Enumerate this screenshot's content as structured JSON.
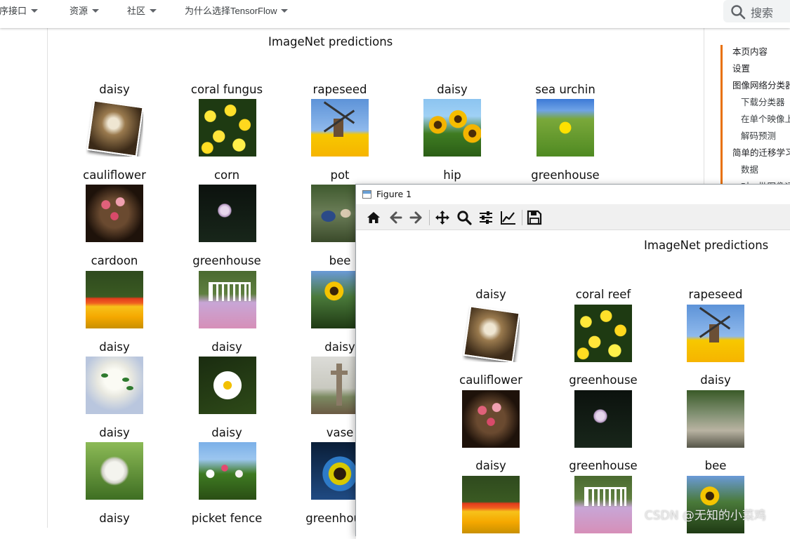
{
  "nav": {
    "items": [
      {
        "label": "程序接口"
      },
      {
        "label": "资源"
      },
      {
        "label": "社区"
      },
      {
        "label": "为什么选择TensorFlow"
      }
    ],
    "search_placeholder": "搜索"
  },
  "main_figure": {
    "title": "ImageNet predictions",
    "rows": [
      [
        "daisy",
        "coral fungus",
        "rapeseed",
        "daisy",
        "sea urchin"
      ],
      [
        "cauliflower",
        "corn",
        "pot",
        "hip",
        "greenhouse"
      ],
      [
        "cardoon",
        "greenhouse",
        "bee"
      ],
      [
        "daisy",
        "daisy",
        "daisy"
      ],
      [
        "daisy",
        "daisy",
        "vase"
      ],
      [
        "daisy",
        "picket fence",
        "greenhouse"
      ]
    ]
  },
  "toc": {
    "items": [
      {
        "label": "本页内容",
        "level": 0
      },
      {
        "label": "设置",
        "level": 0
      },
      {
        "label": "图像网络分类器",
        "level": 0
      },
      {
        "label": "下载分类器",
        "level": 1
      },
      {
        "label": "在单个映像上运行",
        "level": 1
      },
      {
        "label": "解码预测",
        "level": 1
      },
      {
        "label": "简单的迁移学习",
        "level": 0
      },
      {
        "label": "数据",
        "level": 1
      },
      {
        "label": "对一批图像运行",
        "level": 1
      }
    ]
  },
  "figure_window": {
    "title": "Figure 1",
    "plot_title": "ImageNet predictions",
    "toolbar": [
      "home-icon",
      "back-icon",
      "forward-icon",
      "pan-icon",
      "zoom-icon",
      "configure-subplots-icon",
      "edit-axis-icon",
      "save-icon"
    ],
    "rows": [
      [
        "daisy",
        "coral reef",
        "rapeseed"
      ],
      [
        "cauliflower",
        "greenhouse",
        "daisy"
      ],
      [
        "daisy",
        "greenhouse",
        "bee"
      ]
    ]
  },
  "watermark": "CSDN @无知的小菜鸡"
}
